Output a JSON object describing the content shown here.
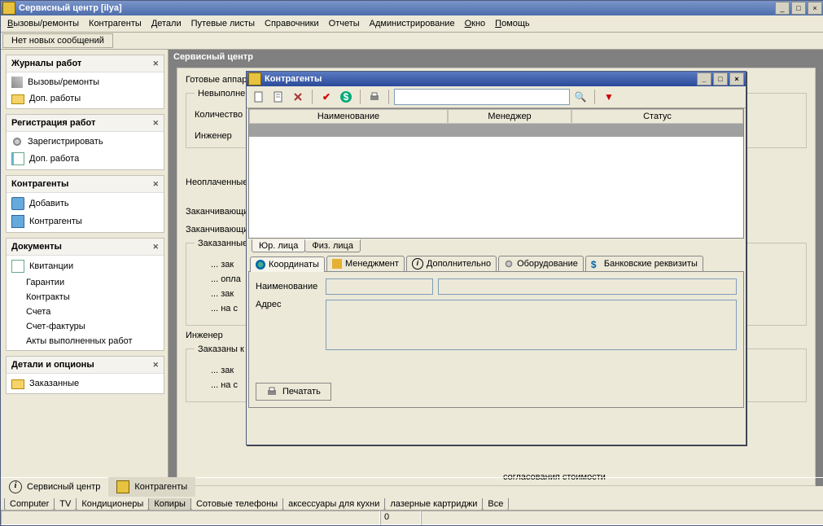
{
  "window": {
    "title": "Сервисный центр [ilya]"
  },
  "menu": {
    "calls": "Вызовы/ремонты",
    "contragents": "Контрагенты",
    "details": "Детали",
    "routes": "Путевые листы",
    "refs": "Справочники",
    "reports": "Отчеты",
    "admin": "Администрирование",
    "window": "Окно",
    "help": "Помощь"
  },
  "messages": {
    "none": "Нет новых сообщений"
  },
  "sidebar": {
    "journals": {
      "title": "Журналы работ",
      "calls": "Вызовы/ремонты",
      "extra": "Доп. работы"
    },
    "registration": {
      "title": "Регистрация работ",
      "register": "Зарегистрировать",
      "extra": "Доп. работа"
    },
    "contragents": {
      "title": "Контрагенты",
      "add": "Добавить",
      "list": "Контрагенты"
    },
    "documents": {
      "title": "Документы",
      "receipts": "Квитанции",
      "warranties": "Гарантии",
      "contracts": "Контракты",
      "invoices": "Счета",
      "factures": "Счет-фактуры",
      "acts": "Акты выполненных работ"
    },
    "details": {
      "title": "Детали и опционы",
      "ordered": "Заказанные"
    }
  },
  "mdi": {
    "title": "Сервисный центр",
    "bg": {
      "ready": "Готовые аппар",
      "unfinished": "Невыполненн",
      "qty": "Количество",
      "engineer": "Инженер",
      "unpaid": "Неоплаченные",
      "ending1": "Заканчивающи",
      "ending2": "Заканчивающи",
      "ordered": "Заказанные",
      "d1": "... зак",
      "d2": "... опла",
      "d3": "... зак",
      "d4": "... на с",
      "engineer2": "Инженер",
      "ordered_k": "Заказаны к",
      "d5": "... зак",
      "d6": "... на с",
      "agreement": "согласования стоимости"
    }
  },
  "inner": {
    "title": "Контрагенты",
    "grid": {
      "col1": "Наименование",
      "col2": "Менеджер",
      "col3": "Статус"
    },
    "bottom_tabs": {
      "legal": "Юр. лица",
      "physical": "Физ. лица"
    },
    "top_tabs": {
      "coords": "Координаты",
      "mgmt": "Менеджмент",
      "extra": "Дополнительно",
      "equip": "Оборудование",
      "bank": "Банковские реквизиты"
    },
    "details": {
      "name": "Наименование",
      "address": "Адрес",
      "print": "Печатать"
    }
  },
  "taskbar": {
    "service": "Сервисный центр",
    "contragents": "Контрагенты"
  },
  "footer_tabs": {
    "computer": "Computer",
    "tv": "TV",
    "cond": "Кондиционеры",
    "copy": "Копиры",
    "phones": "Сотовые телефоны",
    "kitchen": "аксессуары для кухни",
    "laser": "лазерные картриджи",
    "all": "Все"
  },
  "status": {
    "zero": "0"
  }
}
